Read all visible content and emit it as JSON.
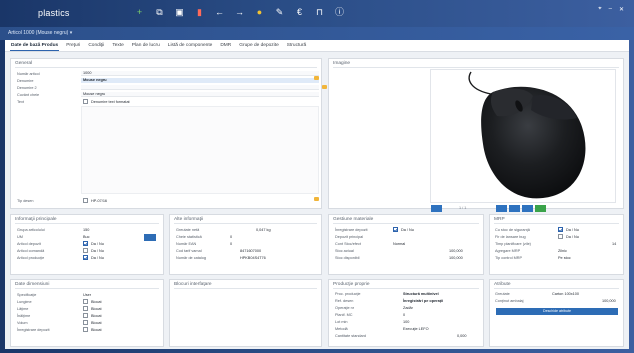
{
  "app": {
    "name": "plastics",
    "breadcrumb": "Articol 1000 (Mouse negru) ▾"
  },
  "tabs": [
    "Date de bază Produs",
    "Preţuri",
    "Condiţii",
    "Texte",
    "Plan de lucru",
    "Listă de componente",
    "DMR",
    "Grupe de depozite",
    "Structură"
  ],
  "general": {
    "title": "General",
    "fields": [
      {
        "label": "Număr articol",
        "value": "1000"
      },
      {
        "label": "Denumire",
        "value": "Mouse negru"
      },
      {
        "label": "Denumire 2",
        "value": ""
      },
      {
        "label": "Cuvânt cheie",
        "value": "Mouse negru"
      },
      {
        "label": "Text",
        "value": "Denumire text formatat"
      }
    ],
    "footer_label": "Tip desen",
    "footer_value": "HP-07/16"
  },
  "image": {
    "title": "Imagine",
    "caption": "1 / 1"
  },
  "info_principal": {
    "title": "Informaţii principale",
    "rows": [
      {
        "label": "Grupa articolului",
        "value": "150"
      },
      {
        "label": "UM",
        "value": "Buc"
      },
      {
        "label": "Articol depozit",
        "value": "Da / Nu"
      },
      {
        "label": "Articol comandă",
        "value": "Da / Nu"
      },
      {
        "label": "Articol producţie",
        "value": "Da / Nu"
      }
    ]
  },
  "info_add": {
    "title": "Alte informaţii",
    "rows": [
      {
        "label": "Greutate netă",
        "value": "0,047 kg"
      },
      {
        "label": "Cheie statistică",
        "value": "0"
      },
      {
        "label": "Număr EAN",
        "value": "0"
      },
      {
        "label": "Cod tarif vamal",
        "value": "8471607000"
      },
      {
        "label": "Număr de catalog",
        "value": "HPKB04S4T76"
      }
    ]
  },
  "stock": {
    "title": "Gestiune materiale",
    "rows": [
      {
        "label": "Înregistrare depozit",
        "value": "Da / Nu"
      },
      {
        "label": "Depozit principal",
        "value": ""
      },
      {
        "label": "Cont Stoc/efect",
        "value": "Normal"
      },
      {
        "label": "Stoc actual",
        "value": "100,000"
      },
      {
        "label": "Stoc disponibil",
        "value": "100,000"
      }
    ]
  },
  "mrp": {
    "title": "MRP",
    "rows": [
      {
        "label": "Cu stoc de siguranţă",
        "value": "Da / Nu"
      },
      {
        "label": "Fir de lansare bug",
        "value": "Da / Nu"
      },
      {
        "label": "Timp planificare (zile)",
        "value": "14"
      },
      {
        "label": "Agregare MRP",
        "value": "Zilnic"
      },
      {
        "label": "Tip control MRP",
        "value": "Pe stoc"
      }
    ]
  },
  "dim": {
    "title": "Date dimensiuni",
    "rows": [
      {
        "label": "Specificaţie",
        "value": "User"
      },
      {
        "label": "Lungime",
        "value": "Blocat"
      },
      {
        "label": "Lăţime",
        "value": "Blocat"
      },
      {
        "label": "Înălţime",
        "value": "Blocat"
      },
      {
        "label": "Volum",
        "value": "Blocat"
      },
      {
        "label": "Înregistrare depozit",
        "value": "Blocat"
      }
    ]
  },
  "extra": {
    "title": "Blocuri interfaţare"
  },
  "prod": {
    "title": "Producţie proprie",
    "rows": [
      {
        "label": "Proc. producţie",
        "value": "Structură multinivel"
      },
      {
        "label": "Ref. desen",
        "value": "Înregistrări pe operaţii"
      },
      {
        "label": "Operaţie nr",
        "value": "Zadăr"
      },
      {
        "label": "Planif. MC",
        "value": "0"
      },
      {
        "label": "Lot min",
        "value": "100"
      },
      {
        "label": "Metodă",
        "value": "Execuţie LEFO"
      },
      {
        "label": "Cantitate standard",
        "value": "0,000"
      }
    ]
  },
  "attrs": {
    "title": "Atribute",
    "rows": [
      {
        "label": "Greutate",
        "value": "Carton 100x100"
      },
      {
        "label": "Conţinut ambalaj",
        "value": "100,000"
      }
    ],
    "button": "Deschide atribute"
  }
}
